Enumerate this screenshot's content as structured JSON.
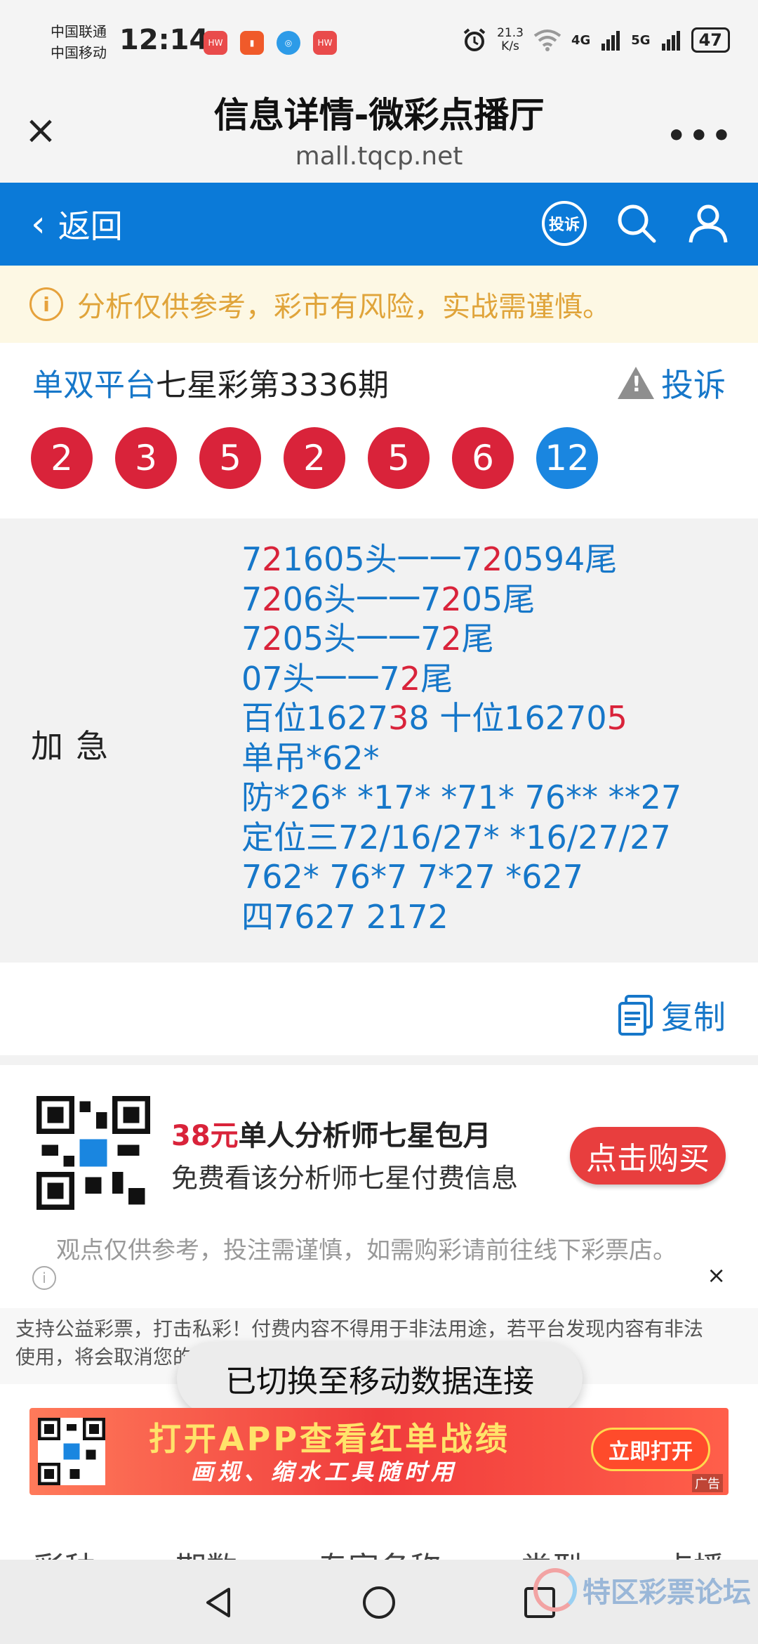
{
  "status_bar": {
    "carrier_1": "中国联通",
    "carrier_2": "中国移动",
    "time": "12:14",
    "net_speed_value": "21.3",
    "net_speed_unit": "K/s",
    "network_1": "4G",
    "network_2": "5G",
    "battery": "47"
  },
  "browser": {
    "title": "信息详情-微彩点播厅",
    "url": "mall.tqcp.net"
  },
  "nav": {
    "back_label": "返回",
    "complain_icon_label": "投诉"
  },
  "warning": {
    "text": "分析仅供参考，彩市有风险，实战需谨慎。"
  },
  "lottery": {
    "platform": "单双平台",
    "issue": "七星彩第3336期",
    "report_label": "投诉",
    "balls": [
      {
        "value": "2",
        "color": "#d9233a"
      },
      {
        "value": "3",
        "color": "#d9233a"
      },
      {
        "value": "5",
        "color": "#d9233a"
      },
      {
        "value": "2",
        "color": "#d9233a"
      },
      {
        "value": "5",
        "color": "#d9233a"
      },
      {
        "value": "6",
        "color": "#d9233a"
      },
      {
        "value": "12",
        "color": "#1a86e0"
      }
    ]
  },
  "content": {
    "label": "加急",
    "lines": [
      [
        {
          "t": "7"
        },
        {
          "t": "2",
          "red": true
        },
        {
          "t": "1605头一一7"
        },
        {
          "t": "2",
          "red": true
        },
        {
          "t": "0594尾"
        }
      ],
      [
        {
          "t": "7"
        },
        {
          "t": "2",
          "red": true
        },
        {
          "t": "06头一一7"
        },
        {
          "t": "2",
          "red": true
        },
        {
          "t": "05尾"
        }
      ],
      [
        {
          "t": "7"
        },
        {
          "t": "2",
          "red": true
        },
        {
          "t": "05头一一7"
        },
        {
          "t": "2",
          "red": true
        },
        {
          "t": "尾"
        }
      ],
      [
        {
          "t": "07头一一7"
        },
        {
          "t": "2",
          "red": true
        },
        {
          "t": "尾"
        }
      ],
      [
        {
          "t": "百位1627"
        },
        {
          "t": "3",
          "red": true
        },
        {
          "t": "8 十位16270"
        },
        {
          "t": "5",
          "red": true
        }
      ],
      [
        {
          "t": "单吊*62*"
        }
      ],
      [
        {
          "t": "防*26* *17* *71* 76** **27"
        }
      ],
      [
        {
          "t": "定位三72/16/27* *16/27/27"
        }
      ],
      [
        {
          "t": "762* 76*7 7*27 *627"
        }
      ],
      [
        {
          "t": "四7627 2172"
        }
      ]
    ],
    "copy_label": "复制"
  },
  "ad": {
    "price": "38元",
    "title": "单人分析师七星包月",
    "subtitle": "免费看该分析师七星付费信息",
    "button": "点击购买",
    "disclaimer": "观点仅供参考，投注需谨慎，如需购彩请前往线下彩票店。",
    "close": "×"
  },
  "notice": {
    "line1": "支持公益彩票，打击私彩！付费内容不得用于非法用途，若平台发现内容有非法",
    "line2": "使用，将会取消您的会员权利！"
  },
  "toast": "已切换至移动数据连接",
  "banner": {
    "main": "打开APP查看红单战绩",
    "sub": "画规、缩水工具随时用",
    "button": "立即打开",
    "ad_tag": "广告"
  },
  "table_header": [
    "彩种",
    "期数",
    "专家名称",
    "类型",
    "点播"
  ],
  "watermark": "特区彩票论坛"
}
